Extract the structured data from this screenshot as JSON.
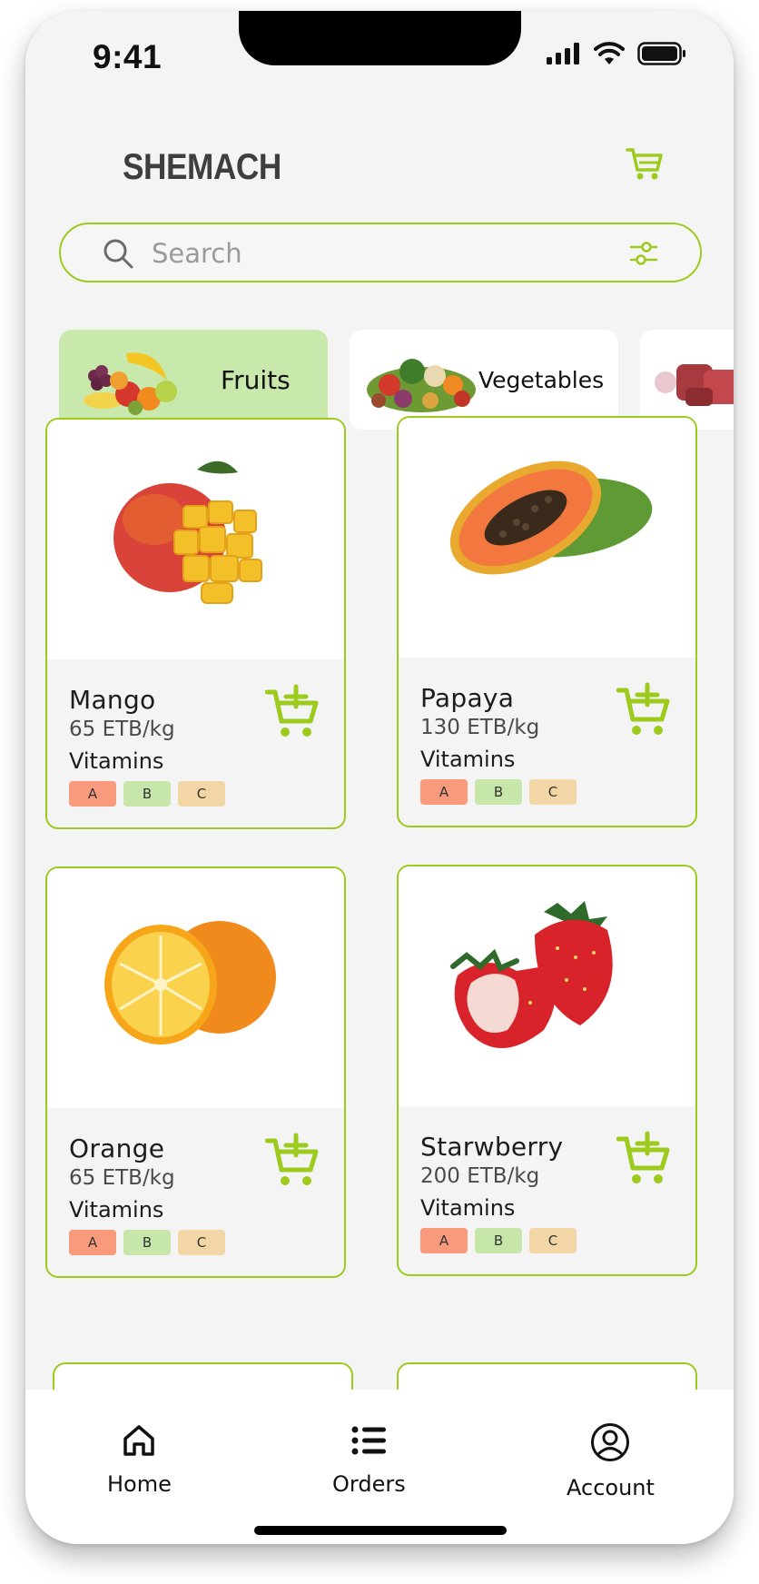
{
  "status_bar": {
    "time": "9:41"
  },
  "header": {
    "brand": "SHEMACH"
  },
  "search": {
    "placeholder": "Search"
  },
  "categories": [
    {
      "label": "Fruits",
      "active": true
    },
    {
      "label": "Vegetables",
      "active": false
    },
    {
      "label": "",
      "active": false
    }
  ],
  "products": [
    {
      "name": "Mango",
      "price": "65 ETB/kg",
      "vitamins_label": "Vitamins",
      "vitamins": [
        "A",
        "B",
        "C"
      ]
    },
    {
      "name": "Papaya",
      "price": "130 ETB/kg",
      "vitamins_label": "Vitamins",
      "vitamins": [
        "A",
        "B",
        "C"
      ]
    },
    {
      "name": "Orange",
      "price": "65 ETB/kg",
      "vitamins_label": "Vitamins",
      "vitamins": [
        "A",
        "B",
        "C"
      ]
    },
    {
      "name": "Starwberry",
      "price": "200 ETB/kg",
      "vitamins_label": "Vitamins",
      "vitamins": [
        "A",
        "B",
        "C"
      ]
    }
  ],
  "nav": [
    {
      "label": "Home",
      "icon": "home-icon"
    },
    {
      "label": "Orders",
      "icon": "list-icon"
    },
    {
      "label": "Account",
      "icon": "account-icon"
    }
  ],
  "colors": {
    "accent": "#9ccb1d",
    "active_category": "#c8e8ac",
    "vitamin_a": "#f99a7d",
    "vitamin_b": "#c6e7a9",
    "vitamin_c": "#f3d6a5"
  }
}
